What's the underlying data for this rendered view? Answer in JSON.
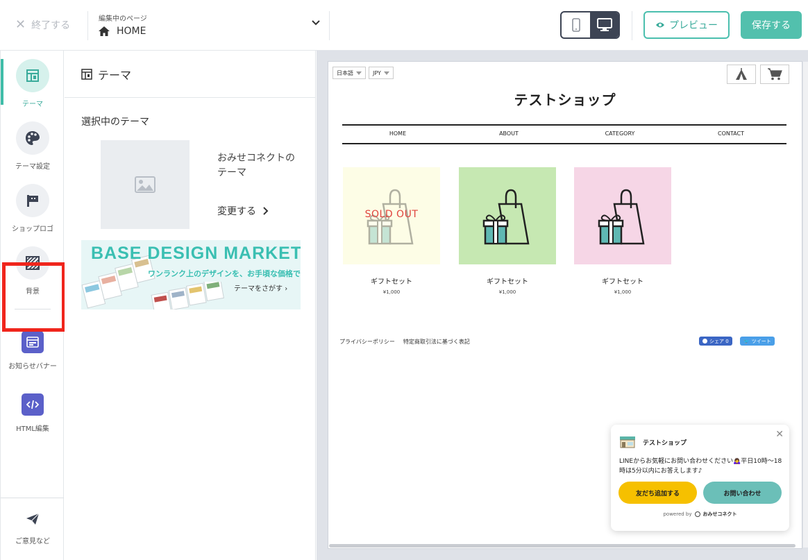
{
  "header": {
    "close_label": "終了する",
    "editing_caption": "編集中のページ",
    "current_page": "HOME",
    "preview_label": "プレビュー",
    "save_label": "保存する"
  },
  "sidebar": {
    "items": [
      {
        "label": "テーマ",
        "icon": "layout-icon"
      },
      {
        "label": "テーマ設定",
        "icon": "palette-icon"
      },
      {
        "label": "ショップロゴ",
        "icon": "flag-icon"
      },
      {
        "label": "背景",
        "icon": "stripes-icon"
      },
      {
        "label": "お知らせバナー",
        "icon": "banner-icon"
      },
      {
        "label": "HTML編集",
        "icon": "code-icon"
      },
      {
        "label": "ご意見など",
        "icon": "paper-plane-icon"
      }
    ]
  },
  "panel": {
    "title": "テーマ",
    "selected_heading": "選択中のテーマ",
    "theme_name": "おみせコネクトのテーマ",
    "change_label": "変更する",
    "banner": {
      "title": "BASE DESIGN MARKET",
      "tagline": "ワンランク上のデザインを、お手頃な価格で",
      "cta": "テーマをさがす"
    }
  },
  "preview": {
    "language": "日本語",
    "currency": "JPY",
    "shop_title": "テストショップ",
    "nav": [
      "HOME",
      "ABOUT",
      "CATEGORY",
      "CONTACT"
    ],
    "products": [
      {
        "name": "ギフトセット",
        "price": "¥1,000",
        "bg": "#fdfde6",
        "sold_out": true
      },
      {
        "name": "ギフトセット",
        "price": "¥1,000",
        "bg": "#c6e8b2",
        "sold_out": false
      },
      {
        "name": "ギフトセット",
        "price": "¥1,000",
        "bg": "#f6d6e6",
        "sold_out": false
      }
    ],
    "sold_out_label": "SOLD OUT",
    "footer_links": [
      "プライバシーポリシー",
      "特定商取引法に基づく表記"
    ],
    "share_label": "シェア 0",
    "tweet_label": "ツイート"
  },
  "chat_widget": {
    "shop_name": "テストショップ",
    "message": "LINEからお気軽にお問い合わせください🙇‍♀️平日10時〜18時は5分以内にお答えします♪",
    "add_friend_label": "友だち追加する",
    "contact_label": "お問い合わせ",
    "powered_by": "powered by",
    "brand": "おみせコネクト"
  },
  "colors": {
    "accent": "#52c0ad",
    "dark": "#3d4454",
    "purple": "#5b60c9",
    "highlight": "#f0251c",
    "chat_yellow": "#f6c000",
    "chat_teal": "#6bbfb8"
  }
}
